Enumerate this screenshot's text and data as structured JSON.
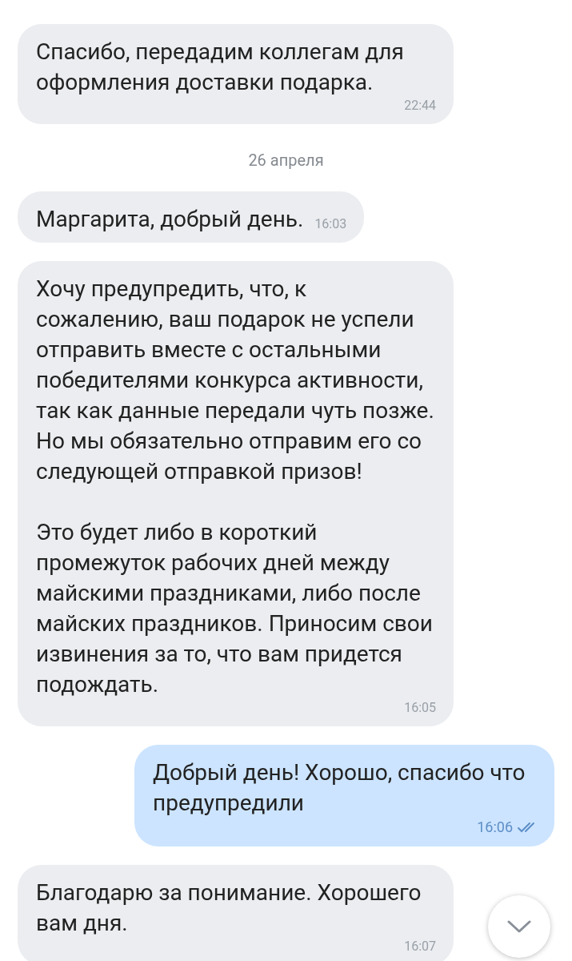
{
  "messages": [
    {
      "kind": "message",
      "outgoing": false,
      "paragraphs": [
        "Спасибо, передадим коллегам для оформления доставки подарка."
      ],
      "time": "22:44"
    },
    {
      "kind": "date",
      "label": "26 апреля"
    },
    {
      "kind": "message",
      "outgoing": false,
      "paragraphs": [
        "Маргарита, добрый день."
      ],
      "time": "16:03"
    },
    {
      "kind": "message",
      "outgoing": false,
      "paragraphs": [
        "Хочу предупредить, что, к сожалению, ваш подарок не успели отправить вместе с остальными победителями конкурса активности, так как данные передали чуть позже. Но мы обязательно отправим его со следующей отправкой призов!",
        "Это будет либо в короткий промежуток рабочих дней между майскими праздниками, либо после майских праздников. Приносим свои извинения за то, что вам придется подождать."
      ],
      "time": "16:05"
    },
    {
      "kind": "message",
      "outgoing": true,
      "paragraphs": [
        "Добрый день! Хорошо, спасибо что предупредили"
      ],
      "time": "16:06",
      "read": true
    },
    {
      "kind": "message",
      "outgoing": false,
      "paragraphs": [
        "Благодарю за понимание. Хорошего вам дня."
      ],
      "time": "16:07"
    }
  ]
}
